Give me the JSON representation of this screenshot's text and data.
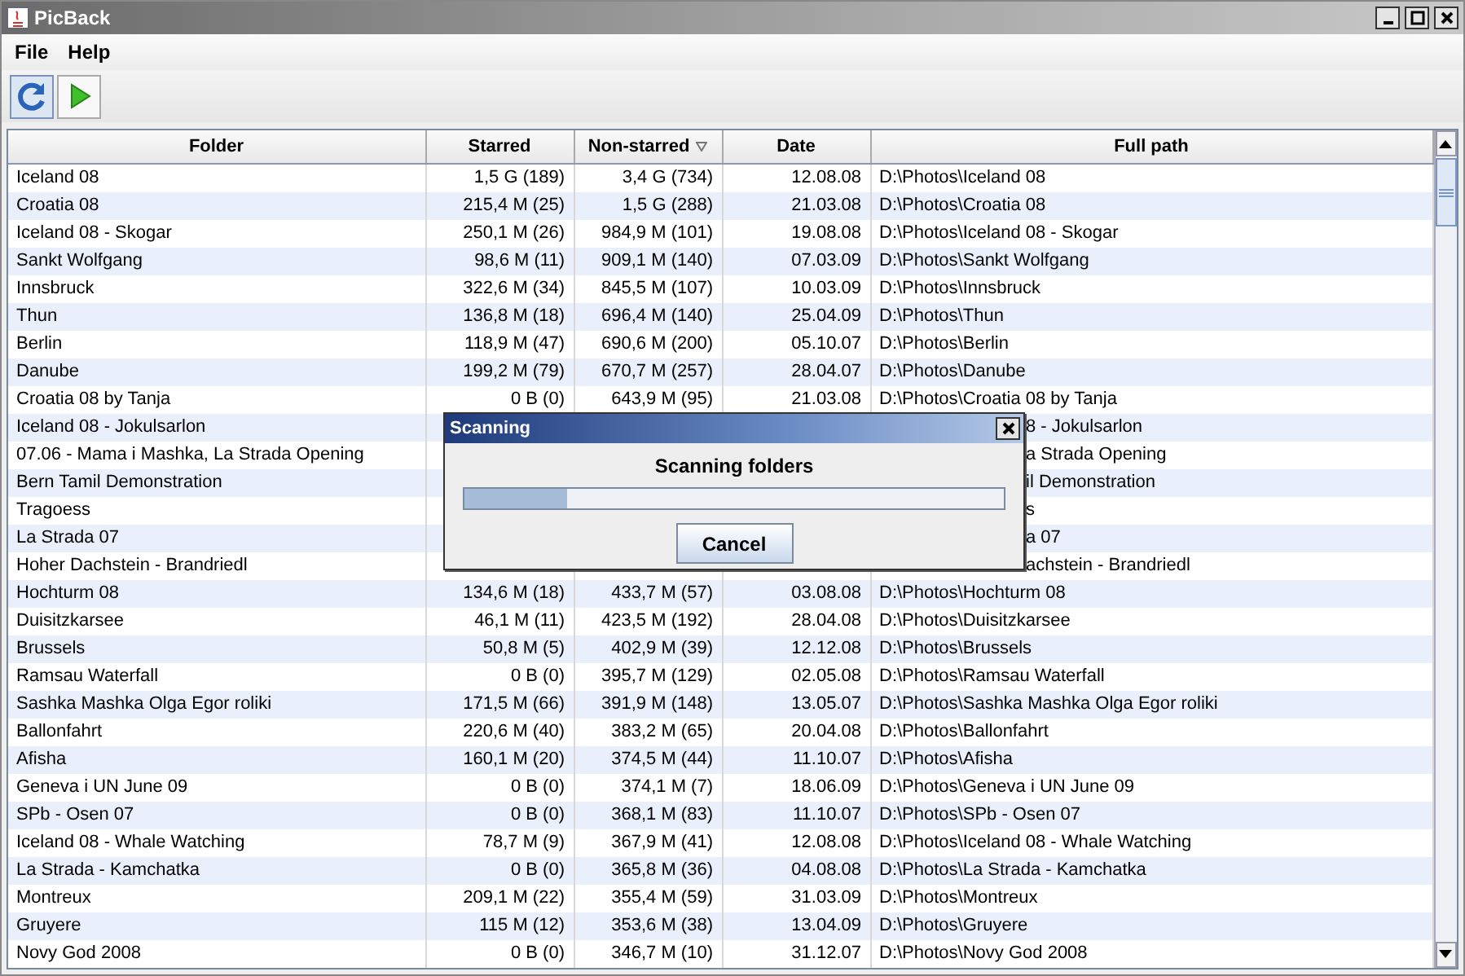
{
  "window": {
    "title": "PicBack"
  },
  "menu": [
    "File",
    "Help"
  ],
  "toolbar": [
    {
      "kind": "refresh",
      "selected": true
    },
    {
      "kind": "run",
      "selected": false
    }
  ],
  "table": {
    "columns": [
      {
        "label": "Folder",
        "sorted": false
      },
      {
        "label": "Starred",
        "sorted": false
      },
      {
        "label": "Non-starred",
        "sorted": true
      },
      {
        "label": "Date",
        "sorted": false
      },
      {
        "label": "Full path",
        "sorted": false
      }
    ],
    "rows": [
      {
        "kind": "full",
        "folder": "Iceland 08",
        "starred": "1,5 G (189)",
        "non_starred": "3,4 G (734)",
        "date": "12.08.08",
        "path": "D:\\Photos\\Iceland 08"
      },
      {
        "kind": "full",
        "folder": "Croatia 08",
        "starred": "215,4 M (25)",
        "non_starred": "1,5 G (288)",
        "date": "21.03.08",
        "path": "D:\\Photos\\Croatia 08"
      },
      {
        "kind": "full",
        "folder": "Iceland 08 - Skogar",
        "starred": "250,1 M (26)",
        "non_starred": "984,9 M (101)",
        "date": "19.08.08",
        "path": "D:\\Photos\\Iceland 08 - Skogar"
      },
      {
        "kind": "full",
        "folder": "Sankt Wolfgang",
        "starred": "98,6 M (11)",
        "non_starred": "909,1 M (140)",
        "date": "07.03.09",
        "path": "D:\\Photos\\Sankt Wolfgang"
      },
      {
        "kind": "full",
        "folder": "Innsbruck",
        "starred": "322,6 M (34)",
        "non_starred": "845,5 M (107)",
        "date": "10.03.09",
        "path": "D:\\Photos\\Innsbruck"
      },
      {
        "kind": "full",
        "folder": "Thun",
        "starred": "136,8 M (18)",
        "non_starred": "696,4 M (140)",
        "date": "25.04.09",
        "path": "D:\\Photos\\Thun"
      },
      {
        "kind": "full",
        "folder": "Berlin",
        "starred": "118,9 M (47)",
        "non_starred": "690,6 M (200)",
        "date": "05.10.07",
        "path": "D:\\Photos\\Berlin"
      },
      {
        "kind": "full",
        "folder": "Danube",
        "starred": "199,2 M (79)",
        "non_starred": "670,7 M (257)",
        "date": "28.04.07",
        "path": "D:\\Photos\\Danube"
      },
      {
        "kind": "full",
        "folder": "Croatia 08 by Tanja",
        "starred": "0 B (0)",
        "non_starred": "643,9 M (95)",
        "date": "21.03.08",
        "path": "D:\\Photos\\Croatia 08 by Tanja"
      },
      {
        "kind": "partly_hidden",
        "folder": "Iceland 08 - Jokulsarlon",
        "path": "8 - Jokulsarlon"
      },
      {
        "kind": "partly_hidden",
        "folder": "07.06 - Mama i Mashka, La Strada Opening",
        "path": "a Strada Opening"
      },
      {
        "kind": "partly_hidden",
        "folder": "Bern Tamil Demonstration",
        "path": "il Demonstration"
      },
      {
        "kind": "partly_hidden",
        "folder": "Tragoess",
        "path": "s"
      },
      {
        "kind": "partly_hidden",
        "folder": "La Strada 07",
        "path": "a 07"
      },
      {
        "kind": "partly_hidden",
        "folder": "Hoher Dachstein - Brandriedl",
        "path": "achstein - Brandriedl"
      },
      {
        "kind": "full",
        "folder": "Hochturm 08",
        "starred": "134,6 M (18)",
        "non_starred": "433,7 M (57)",
        "date": "03.08.08",
        "path": "D:\\Photos\\Hochturm 08"
      },
      {
        "kind": "full",
        "folder": "Duisitzkarsee",
        "starred": "46,1 M (11)",
        "non_starred": "423,5 M (192)",
        "date": "28.04.08",
        "path": "D:\\Photos\\Duisitzkarsee"
      },
      {
        "kind": "full",
        "folder": "Brussels",
        "starred": "50,8 M (5)",
        "non_starred": "402,9 M (39)",
        "date": "12.12.08",
        "path": "D:\\Photos\\Brussels"
      },
      {
        "kind": "full",
        "folder": "Ramsau Waterfall",
        "starred": "0 B (0)",
        "non_starred": "395,7 M (129)",
        "date": "02.05.08",
        "path": "D:\\Photos\\Ramsau Waterfall"
      },
      {
        "kind": "full",
        "folder": "Sashka Mashka Olga Egor roliki",
        "starred": "171,5 M (66)",
        "non_starred": "391,9 M (148)",
        "date": "13.05.07",
        "path": "D:\\Photos\\Sashka Mashka Olga Egor roliki"
      },
      {
        "kind": "full",
        "folder": "Ballonfahrt",
        "starred": "220,6 M (40)",
        "non_starred": "383,2 M (65)",
        "date": "20.04.08",
        "path": "D:\\Photos\\Ballonfahrt"
      },
      {
        "kind": "full",
        "folder": "Afisha",
        "starred": "160,1 M (20)",
        "non_starred": "374,5 M (44)",
        "date": "11.10.07",
        "path": "D:\\Photos\\Afisha"
      },
      {
        "kind": "full",
        "folder": "Geneva i UN June 09",
        "starred": "0 B (0)",
        "non_starred": "374,1 M (7)",
        "date": "18.06.09",
        "path": "D:\\Photos\\Geneva i UN June 09"
      },
      {
        "kind": "full",
        "folder": "SPb - Osen 07",
        "starred": "0 B (0)",
        "non_starred": "368,1 M (83)",
        "date": "11.10.07",
        "path": "D:\\Photos\\SPb - Osen 07"
      },
      {
        "kind": "full",
        "folder": "Iceland 08 - Whale Watching",
        "starred": "78,7 M (9)",
        "non_starred": "367,9 M (41)",
        "date": "12.08.08",
        "path": "D:\\Photos\\Iceland 08 - Whale Watching"
      },
      {
        "kind": "full",
        "folder": "La Strada - Kamchatka",
        "starred": "0 B (0)",
        "non_starred": "365,8 M (36)",
        "date": "04.08.08",
        "path": "D:\\Photos\\La Strada - Kamchatka"
      },
      {
        "kind": "full",
        "folder": "Montreux",
        "starred": "209,1 M (22)",
        "non_starred": "355,4 M (59)",
        "date": "31.03.09",
        "path": "D:\\Photos\\Montreux"
      },
      {
        "kind": "full",
        "folder": "Gruyere",
        "starred": "115 M (12)",
        "non_starred": "353,6 M (38)",
        "date": "13.04.09",
        "path": "D:\\Photos\\Gruyere"
      },
      {
        "kind": "full",
        "folder": "Novy God 2008",
        "starred": "0 B (0)",
        "non_starred": "346,7 M (10)",
        "date": "31.12.07",
        "path": "D:\\Photos\\Novy God 2008"
      }
    ]
  },
  "dialog": {
    "title": "Scanning",
    "message": "Scanning folders",
    "progress": {
      "level": 0.19
    },
    "buttons": [
      "Cancel"
    ]
  }
}
